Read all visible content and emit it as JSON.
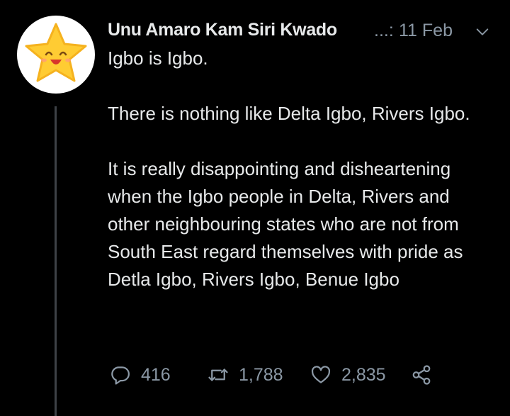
{
  "tweet": {
    "display_name": "Unu Amaro Kam Siri Kwado",
    "handle_truncated": "...:",
    "date": "11 Feb",
    "paragraphs": [
      "Igbo is Igbo.",
      "There is nothing like Delta Igbo, Rivers Igbo.",
      "It is really disappointing and disheartening when the Igbo people in Delta, Rivers and other neighbouring states who are not from South East regard themselves with pride as Detla Igbo, Rivers Igbo, Benue Igbo"
    ]
  },
  "actions": {
    "replies": "416",
    "retweets": "1,788",
    "likes": "2,835"
  },
  "icons": {
    "avatar": "star-emoji",
    "caret": "chevron-down-icon",
    "reply": "reply-icon",
    "retweet": "retweet-icon",
    "like": "heart-icon",
    "share": "share-icon"
  },
  "colors": {
    "background": "#000000",
    "text": "#e7e9ea",
    "secondary": "#8b98a5",
    "thread_line": "#3d4146",
    "star": "#ffcc33"
  }
}
